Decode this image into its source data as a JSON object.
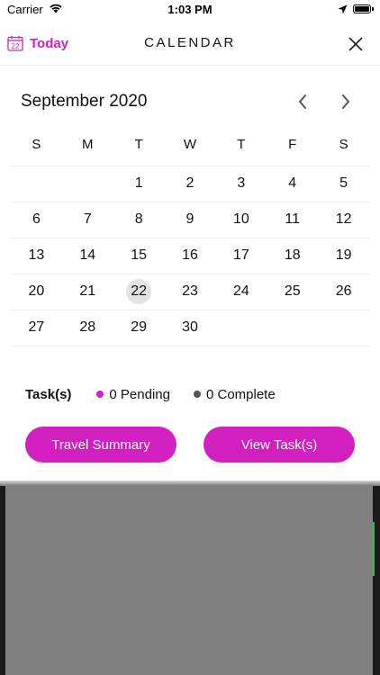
{
  "status_bar": {
    "carrier": "Carrier",
    "time": "1:03 PM"
  },
  "header": {
    "today_label": "Today",
    "today_icon_day": "22",
    "title": "CALENDAR",
    "accent_color": "#d21fc0"
  },
  "calendar": {
    "month_title": "September 2020",
    "weekdays": [
      "S",
      "M",
      "T",
      "W",
      "T",
      "F",
      "S"
    ],
    "weeks": [
      [
        "",
        "",
        "1",
        "2",
        "3",
        "4",
        "5"
      ],
      [
        "6",
        "7",
        "8",
        "9",
        "10",
        "11",
        "12"
      ],
      [
        "13",
        "14",
        "15",
        "16",
        "17",
        "18",
        "19"
      ],
      [
        "20",
        "21",
        "22",
        "23",
        "24",
        "25",
        "26"
      ],
      [
        "27",
        "28",
        "29",
        "30",
        "",
        "",
        ""
      ]
    ],
    "selected_day": "22"
  },
  "tasks": {
    "label": "Task(s)",
    "pending": "0 Pending",
    "complete": "0 Complete"
  },
  "buttons": {
    "travel_summary": "Travel Summary",
    "view_tasks": "View Task(s)"
  },
  "icons": {
    "wifi": "wifi-icon",
    "location": "location-arrow-icon",
    "battery": "battery-icon",
    "calendar": "calendar-icon",
    "close": "close-icon",
    "prev": "chevron-left-icon",
    "next": "chevron-right-icon"
  }
}
